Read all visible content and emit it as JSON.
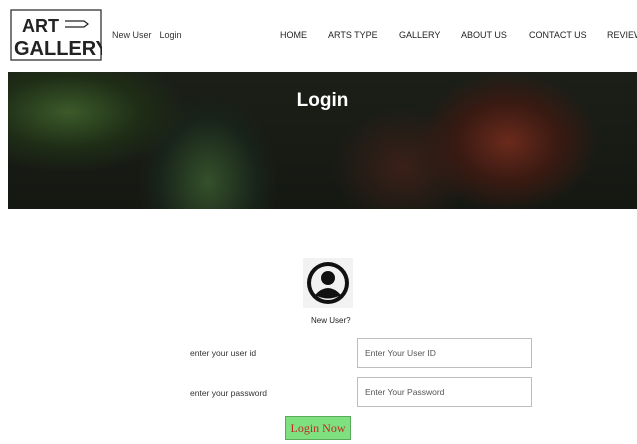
{
  "logo": {
    "line1": "ART",
    "line2": "GALLERY"
  },
  "top_links": [
    "New User",
    "Login"
  ],
  "nav": [
    "HOME",
    "ARTS TYPE",
    "GALLERY",
    "ABOUT US",
    "CONTACT US",
    "REVIEW"
  ],
  "hero": {
    "title": "Login"
  },
  "form": {
    "new_user": "New User?",
    "user_id_label": "enter your user id",
    "user_id_placeholder": "Enter Your User ID",
    "user_id_value": "",
    "password_label": "enter your password",
    "password_placeholder": "Enter Your Password",
    "password_value": "",
    "submit_label": "Login Now"
  },
  "colors": {
    "submit_bg": "#7ee07e",
    "submit_text": "#c62828"
  }
}
